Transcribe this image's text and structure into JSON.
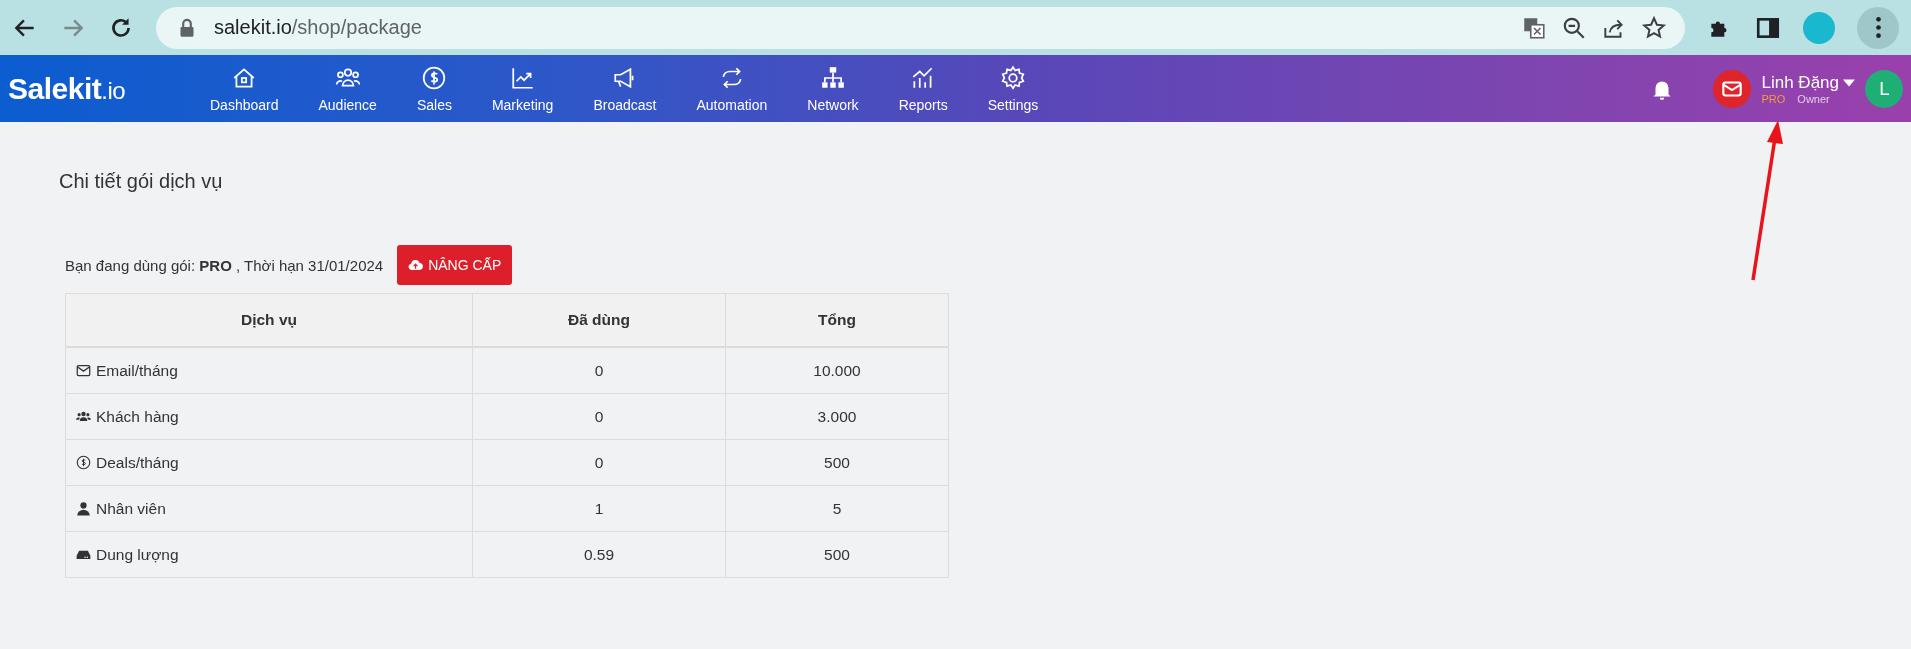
{
  "browser": {
    "url_host": "salekit.io",
    "url_path": "/shop/package"
  },
  "nav": {
    "logo_main": "Salekit",
    "logo_suffix": ".io",
    "items": [
      {
        "label": "Dashboard"
      },
      {
        "label": "Audience"
      },
      {
        "label": "Sales"
      },
      {
        "label": "Marketing"
      },
      {
        "label": "Broadcast"
      },
      {
        "label": "Automation"
      },
      {
        "label": "Network"
      },
      {
        "label": "Reports"
      },
      {
        "label": "Settings"
      }
    ],
    "user": {
      "name": "Linh Đặng",
      "plan": "PRO",
      "role": "Owner",
      "avatar_letter": "L"
    }
  },
  "page": {
    "title": "Chi tiết gói dịch vụ",
    "plan_text": "Bạn đang dùng gói: **PRO** , Thời hạn 31/01/2024",
    "upgrade_button": "NÂNG CẤP"
  },
  "table": {
    "columns": [
      "Dịch vụ",
      "Đã dùng",
      "Tổng"
    ],
    "rows": [
      [
        "Email/tháng",
        "0",
        "10.000"
      ],
      [
        "Khách hàng",
        "0",
        "3.000"
      ],
      [
        "Deals/tháng",
        "0",
        "500"
      ],
      [
        "Nhân viên",
        "1",
        "5"
      ],
      [
        "Dung lượng",
        "0.59",
        "500"
      ]
    ]
  }
}
